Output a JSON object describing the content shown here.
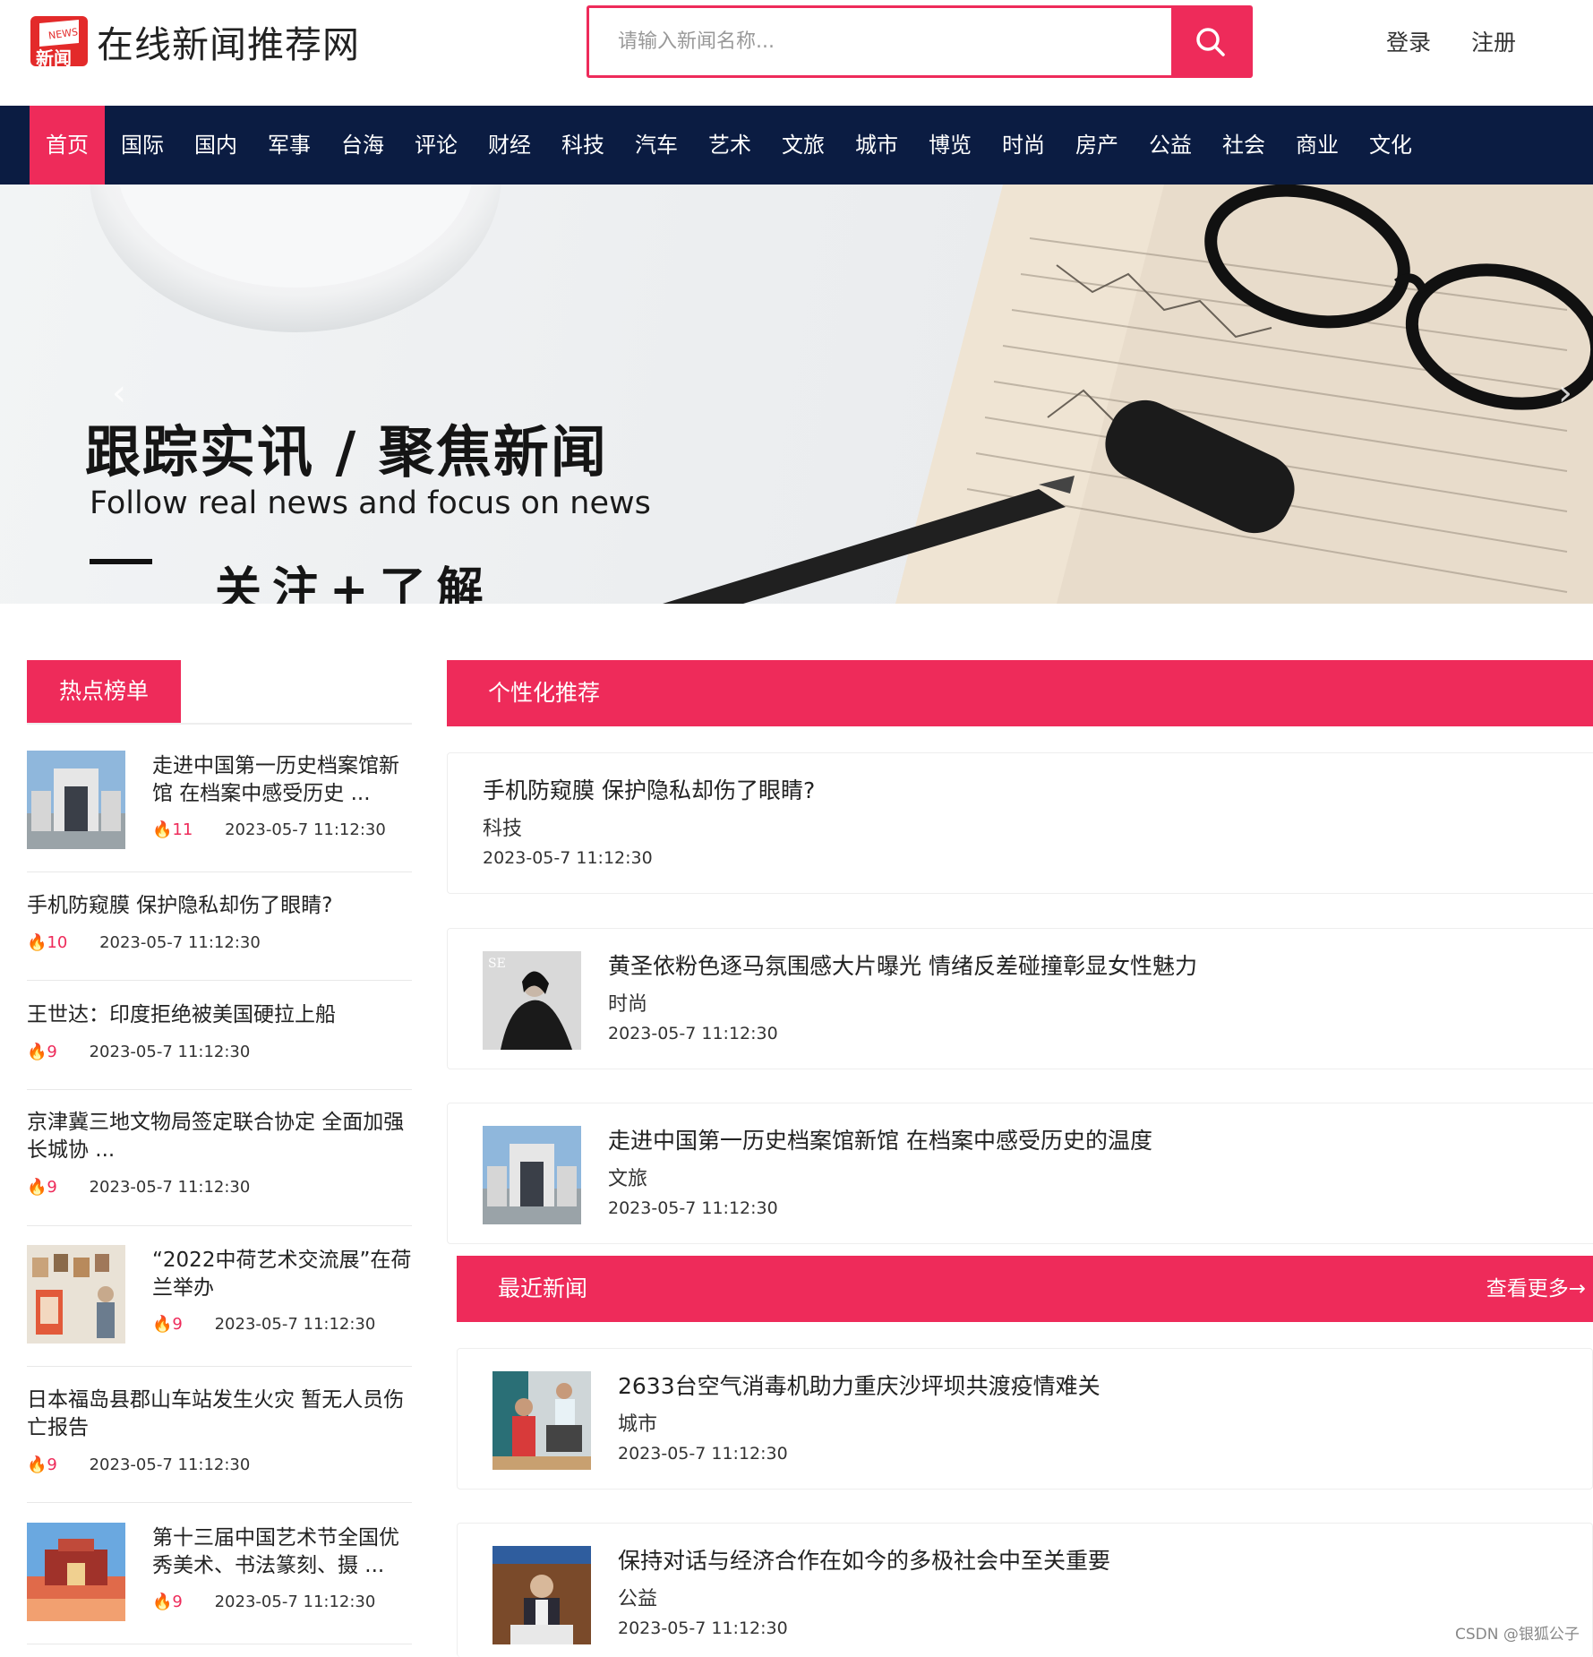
{
  "site": {
    "logo_text": "新闻",
    "logo_badge": "NEWS",
    "title": "在线新闻推荐网"
  },
  "search": {
    "placeholder": "请输入新闻名称..."
  },
  "auth": {
    "login": "登录",
    "register": "注册"
  },
  "nav": [
    "首页",
    "国际",
    "国内",
    "军事",
    "台海",
    "评论",
    "财经",
    "科技",
    "汽车",
    "艺术",
    "文旅",
    "城市",
    "博览",
    "时尚",
    "房产",
    "公益",
    "社会",
    "商业",
    "文化"
  ],
  "banner": {
    "title": "跟踪实讯 / 聚焦新闻",
    "subtitle": "Follow real news and focus on news",
    "cta": "关注+了解"
  },
  "hot": {
    "tab": "热点榜单",
    "items": [
      {
        "title": "走进中国第一历史档案馆新馆 在档案中感受历史 ...",
        "count": "11",
        "date": "2023-05-7 11:12:30"
      },
      {
        "title": "手机防窥膜 保护隐私却伤了眼睛?",
        "count": "10",
        "date": "2023-05-7 11:12:30"
      },
      {
        "title": "王世达：印度拒绝被美国硬拉上船",
        "count": "9",
        "date": "2023-05-7 11:12:30"
      },
      {
        "title": "京津冀三地文物局签定联合协定 全面加强长城协 ...",
        "count": "9",
        "date": "2023-05-7 11:12:30"
      },
      {
        "title": "“2022中荷艺术交流展”在荷兰举办",
        "count": "9",
        "date": "2023-05-7 11:12:30"
      },
      {
        "title": "日本福岛县郡山车站发生火灾 暂无人员伤亡报告",
        "count": "9",
        "date": "2023-05-7 11:12:30"
      },
      {
        "title": "第十三届中国艺术节全国优秀美术、书法篆刻、摄 ...",
        "count": "9",
        "date": "2023-05-7 11:12:30"
      }
    ]
  },
  "recommend": {
    "header": "个性化推荐",
    "items": [
      {
        "title": "手机防窥膜 保护隐私却伤了眼睛?",
        "category": "科技",
        "date": "2023-05-7 11:12:30"
      },
      {
        "title": "黄圣依粉色逐马氛围感大片曝光 情绪反差碰撞彰显女性魅力",
        "category": "时尚",
        "date": "2023-05-7 11:12:30"
      },
      {
        "title": "走进中国第一历史档案馆新馆 在档案中感受历史的温度",
        "category": "文旅",
        "date": "2023-05-7 11:12:30"
      }
    ]
  },
  "recent": {
    "header": "最近新闻",
    "more": "查看更多→",
    "items": [
      {
        "title": "2633台空气消毒机助力重庆沙坪坝共渡疫情难关",
        "category": "城市",
        "date": "2023-05-7 11:12:30"
      },
      {
        "title": "保持对话与经济合作在如今的多极社会中至关重要",
        "category": "公益",
        "date": "2023-05-7 11:12:30"
      }
    ]
  },
  "watermark": "CSDN @银狐公子",
  "colors": {
    "accent": "#ee2b5a",
    "nav_bg": "#0b1c42"
  }
}
